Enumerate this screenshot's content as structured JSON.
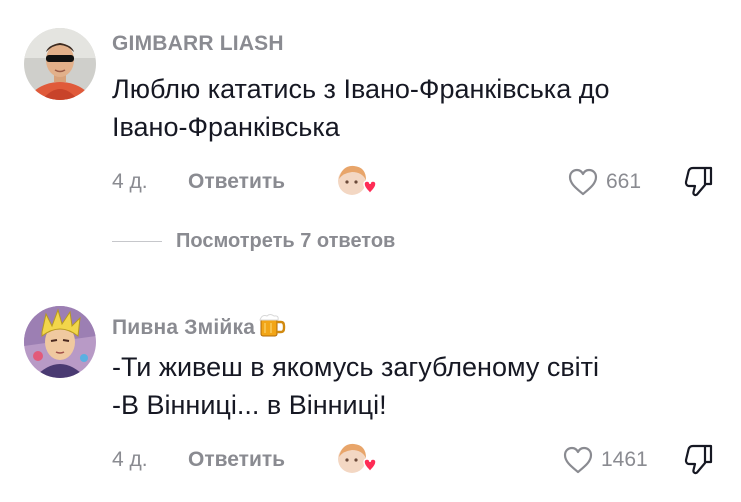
{
  "comments": [
    {
      "author": "GIMBARR LIASH",
      "text": "Люблю кататись з Івано-Франківська до\nІвано-Франківська",
      "date": "4 д.",
      "reply_label": "Ответить",
      "likes": "661",
      "avatar_icon": "avatar-man-sunglasses",
      "creator_liked_icon": "creator-liked-heart"
    },
    {
      "author": "Пивна Змійка",
      "author_emoji": "beer-mug-icon",
      "text": "-Ти живеш в якомусь загубленому світі\n-В Вінниці... в Вінниці!",
      "date": "4 д.",
      "reply_label": "Ответить",
      "likes": "1461",
      "avatar_icon": "avatar-anime-character",
      "creator_liked_icon": "creator-liked-heart"
    }
  ],
  "view_replies": "Посмотреть 7 ответов",
  "colors": {
    "text": "#161823",
    "muted": "#8a8b91",
    "heart": "#fe2c55"
  }
}
